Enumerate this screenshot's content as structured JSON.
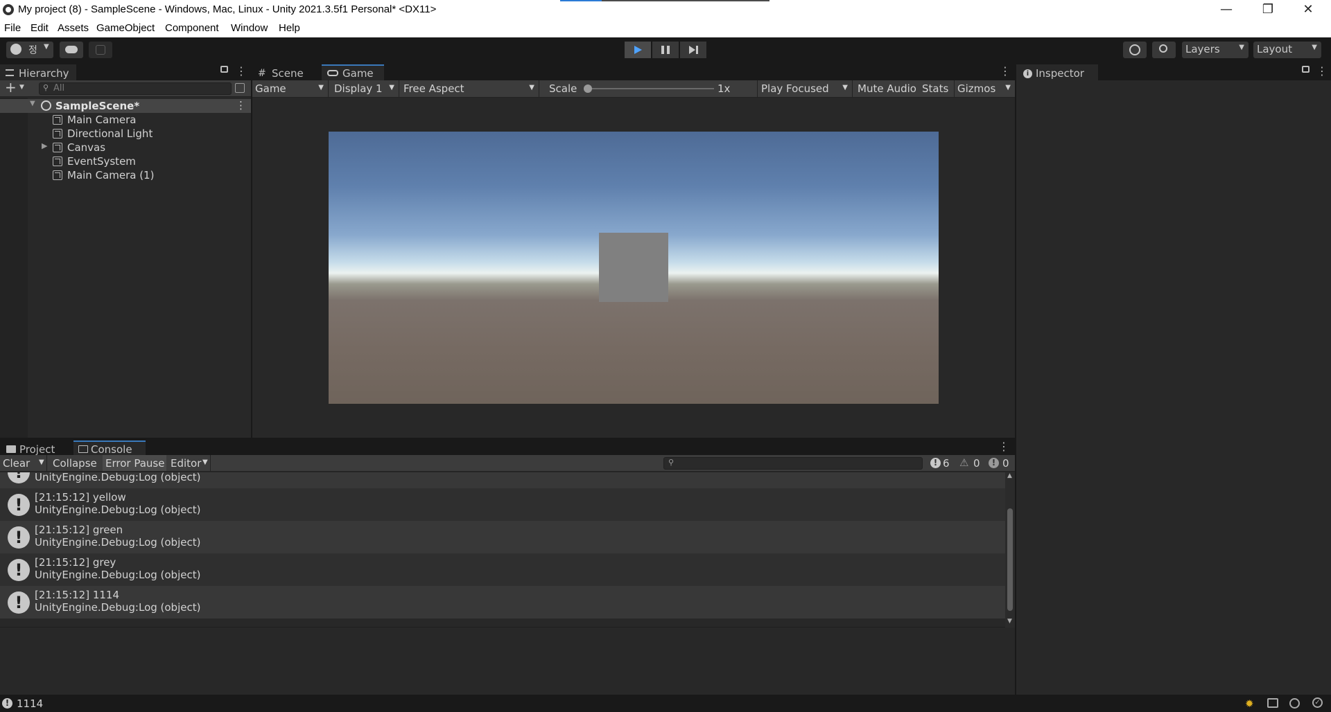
{
  "window": {
    "title": "My project (8) - SampleScene - Windows, Mac, Linux - Unity 2021.3.5f1 Personal* <DX11>",
    "controls": {
      "minimize": "—",
      "maximize": "❐",
      "close": "✕"
    }
  },
  "menu": [
    "File",
    "Edit",
    "Assets",
    "GameObject",
    "Component",
    "Window",
    "Help"
  ],
  "toolbar": {
    "account_label": "정",
    "layers_label": "Layers",
    "layout_label": "Layout",
    "play_state": "playing",
    "accent_color": "#3a79bb"
  },
  "hierarchy": {
    "tab_label": "Hierarchy",
    "add_label": "+",
    "search_placeholder": "All",
    "scene_name": "SampleScene*",
    "items": [
      {
        "label": "Main Camera",
        "expandable": false
      },
      {
        "label": "Directional Light",
        "expandable": false
      },
      {
        "label": "Canvas",
        "expandable": true
      },
      {
        "label": "EventSystem",
        "expandable": false
      },
      {
        "label": "Main Camera (1)",
        "expandable": false
      }
    ]
  },
  "center": {
    "tabs": [
      {
        "label": "Scene",
        "icon": "grid-icon",
        "active": false
      },
      {
        "label": "Game",
        "icon": "gamepad-icon",
        "active": true
      }
    ],
    "game_toolbar": {
      "view_mode": "Game",
      "display": "Display 1",
      "aspect": "Free Aspect",
      "scale_label": "Scale",
      "scale_value": "1x",
      "play_mode": "Play Focused",
      "mute_audio": "Mute Audio",
      "stats": "Stats",
      "gizmos": "Gizmos"
    }
  },
  "inspector": {
    "tab_label": "Inspector"
  },
  "bottom": {
    "tabs": [
      {
        "label": "Project",
        "icon": "folder-icon",
        "active": false
      },
      {
        "label": "Console",
        "icon": "console-icon",
        "active": true
      }
    ],
    "console_toolbar": {
      "clear": "Clear",
      "collapse": "Collapse",
      "error_pause": "Error Pause",
      "editor": "Editor",
      "info_count": "6",
      "warning_count": "0",
      "error_count": "0"
    },
    "partial_row": {
      "line2": "UnityEngine.Debug:Log (object)"
    },
    "logs": [
      {
        "line1": "[21:15:12] yellow",
        "line2": "UnityEngine.Debug:Log (object)"
      },
      {
        "line1": "[21:15:12] green",
        "line2": "UnityEngine.Debug:Log (object)"
      },
      {
        "line1": "[21:15:12] grey",
        "line2": "UnityEngine.Debug:Log (object)"
      },
      {
        "line1": "[21:15:12] 1114",
        "line2": "UnityEngine.Debug:Log (object)"
      }
    ]
  },
  "status": {
    "message": "1114"
  }
}
